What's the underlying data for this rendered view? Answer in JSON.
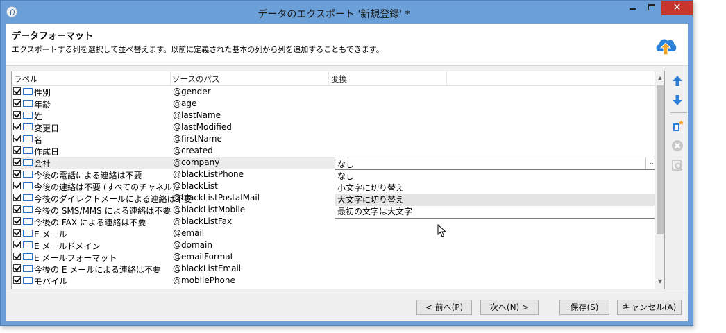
{
  "window": {
    "title": "データのエクスポート '新規登録' *",
    "minimize": "–",
    "maximize": "□",
    "close": "✕"
  },
  "header": {
    "title": "データフォーマット",
    "description": "エクスポートする列を選択して並べ替えます。以前に定義された基本の列から列を追加することもできます。",
    "icon": "cloud-upload-icon"
  },
  "grid": {
    "columns": [
      "ラベル",
      "ソースのパス",
      "変換"
    ],
    "rows": [
      {
        "label": "性別",
        "source": "@gender",
        "checked": true
      },
      {
        "label": "年齢",
        "source": "@age",
        "checked": true
      },
      {
        "label": "姓",
        "source": "@lastName",
        "checked": true
      },
      {
        "label": "変更日",
        "source": "@lastModified",
        "checked": true
      },
      {
        "label": "名",
        "source": "@firstName",
        "checked": true
      },
      {
        "label": "作成日",
        "source": "@created",
        "checked": true
      },
      {
        "label": "会社",
        "source": "@company",
        "checked": true,
        "selected": true,
        "transform": "なし"
      },
      {
        "label": "今後の電話による連絡は不要",
        "source": "@blackListPhone",
        "checked": true
      },
      {
        "label": "今後の連絡は不要 (すべてのチャネル)",
        "source": "@blackList",
        "checked": true
      },
      {
        "label": "今後のダイレクトメールによる連絡は不要",
        "source": "@blackListPostalMail",
        "checked": true
      },
      {
        "label": "今後の SMS/MMS による連絡は不要",
        "source": "@blackListMobile",
        "checked": true
      },
      {
        "label": "今後の FAX による連絡は不要",
        "source": "@blackListFax",
        "checked": true
      },
      {
        "label": "E メール",
        "source": "@email",
        "checked": true
      },
      {
        "label": "E メールドメイン",
        "source": "@domain",
        "checked": true
      },
      {
        "label": "E メールフォーマット",
        "source": "@emailFormat",
        "checked": true
      },
      {
        "label": "今後の E メールによる連絡は不要",
        "source": "@blackListEmail",
        "checked": true
      },
      {
        "label": "モバイル",
        "source": "@mobilePhone",
        "checked": true
      }
    ]
  },
  "transform_dropdown": {
    "selected": "なし",
    "options": [
      "なし",
      "小文字に切り替え",
      "大文字に切り替え",
      "最初の文字は大文字"
    ],
    "hovered": "大文字に切り替え"
  },
  "side_tools": [
    "move-up-icon",
    "move-down-icon",
    "add-column-icon",
    "delete-icon",
    "preview-icon"
  ],
  "buttons": {
    "prev": "< 前へ(P)",
    "next": "次へ(N) >",
    "save": "保存(S)",
    "cancel": "キャンセル(A)"
  },
  "colors": {
    "title_bar": "#6a9fd8",
    "close_button": "#c7352b",
    "accent_blue": "#2c7fd6",
    "upload_orange": "#f5a623"
  }
}
